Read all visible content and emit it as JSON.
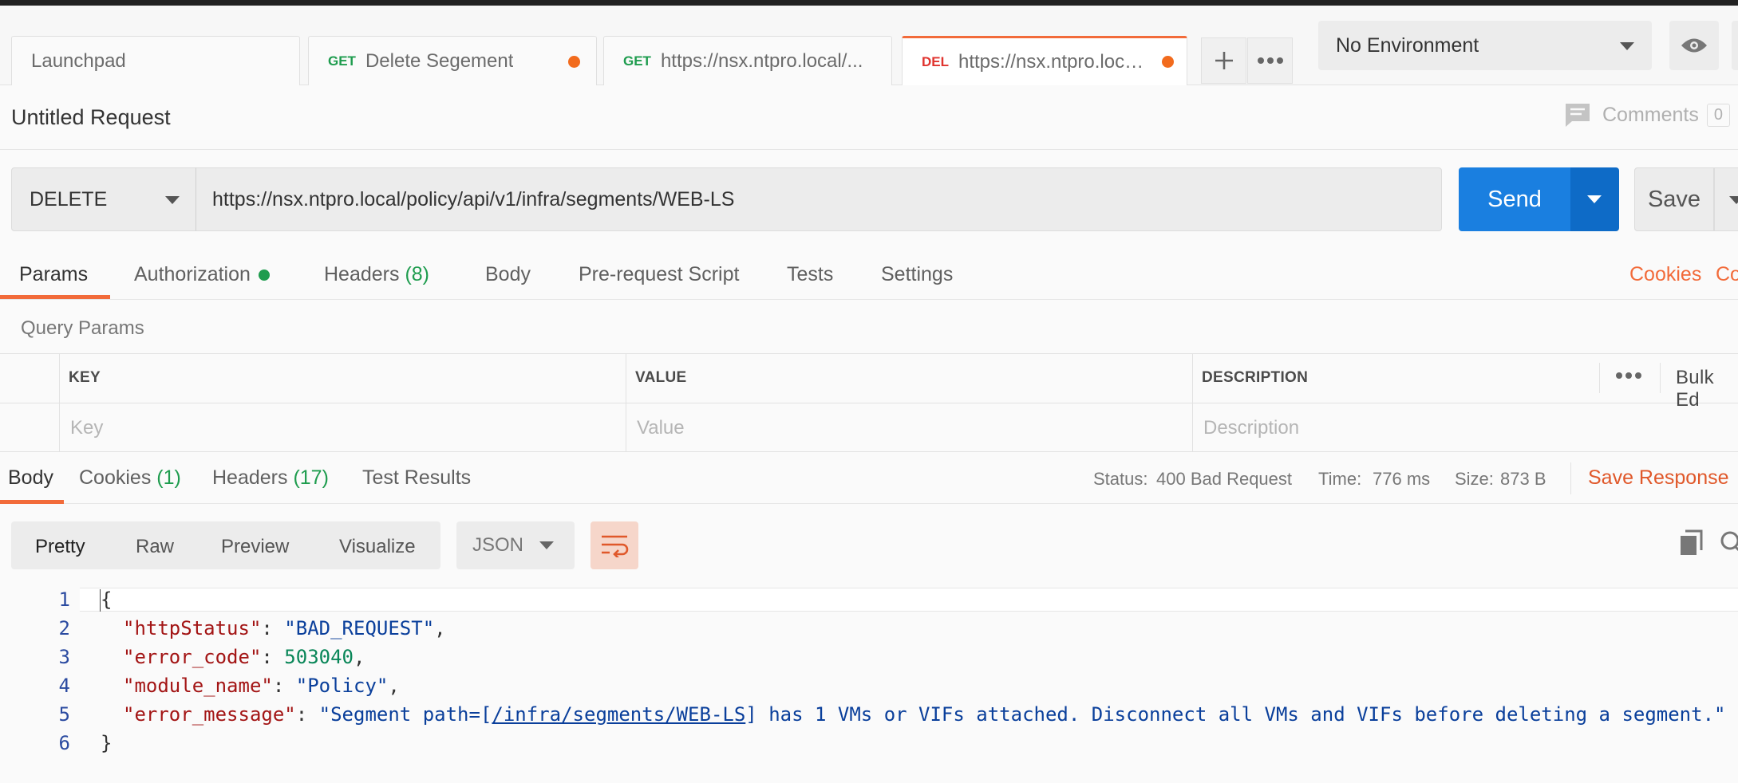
{
  "tabs": [
    {
      "method": "",
      "label": "Launchpad",
      "unsaved": false
    },
    {
      "method": "GET",
      "label": "Delete Segement",
      "unsaved": true
    },
    {
      "method": "GET",
      "label": "https://nsx.ntpro.local/...",
      "unsaved": false
    },
    {
      "method": "DEL",
      "label": "https://nsx.ntpro.local/p...",
      "unsaved": true
    }
  ],
  "environment": {
    "selected": "No Environment"
  },
  "request": {
    "title": "Untitled Request",
    "comments_label": "Comments",
    "comments_count": "0",
    "method": "DELETE",
    "url": "https://nsx.ntpro.local/policy/api/v1/infra/segments/WEB-LS",
    "send_label": "Send",
    "save_label": "Save"
  },
  "request_tabs": {
    "params": "Params",
    "authorization": "Authorization",
    "headers": "Headers",
    "headers_count": "(8)",
    "body": "Body",
    "prerequest": "Pre-request Script",
    "tests": "Tests",
    "settings": "Settings",
    "cookies": "Cookies",
    "code_partial": "Co"
  },
  "query_params": {
    "title": "Query Params",
    "columns": [
      "KEY",
      "VALUE",
      "DESCRIPTION"
    ],
    "bulk_edit": "Bulk Ed",
    "placeholders": {
      "key": "Key",
      "value": "Value",
      "description": "Description"
    }
  },
  "response": {
    "tabs": {
      "body": "Body",
      "cookies": "Cookies",
      "cookies_count": "(1)",
      "headers": "Headers",
      "headers_count": "(17)",
      "test_results": "Test Results"
    },
    "status_label": "Status:",
    "status_value": "400 Bad Request",
    "time_label": "Time:",
    "time_value": "776 ms",
    "size_label": "Size:",
    "size_value": "873 B",
    "save_response": "Save Response",
    "view_modes": [
      "Pretty",
      "Raw",
      "Preview",
      "Visualize"
    ],
    "active_view": "Pretty",
    "format": "JSON",
    "body_lines": {
      "line_numbers": [
        "1",
        "2",
        "3",
        "4",
        "5",
        "6"
      ],
      "open": "{",
      "close": "}",
      "k1": "\"httpStatus\"",
      "v1": "\"BAD_REQUEST\"",
      "k2": "\"error_code\"",
      "v2": "503040",
      "k3": "\"module_name\"",
      "v3": "\"Policy\"",
      "k4": "\"error_message\"",
      "v4a": "\"Segment path=[",
      "v4link": "/infra/segments/WEB-LS",
      "v4b": "] has 1 VMs or VIFs attached. Disconnect all VMs and VIFs before deleting a segment.\""
    }
  },
  "colors": {
    "accent": "#f26b3a",
    "send": "#1a7fe0",
    "success_green": "#1e9c4e",
    "delete_red": "#e0332e"
  }
}
